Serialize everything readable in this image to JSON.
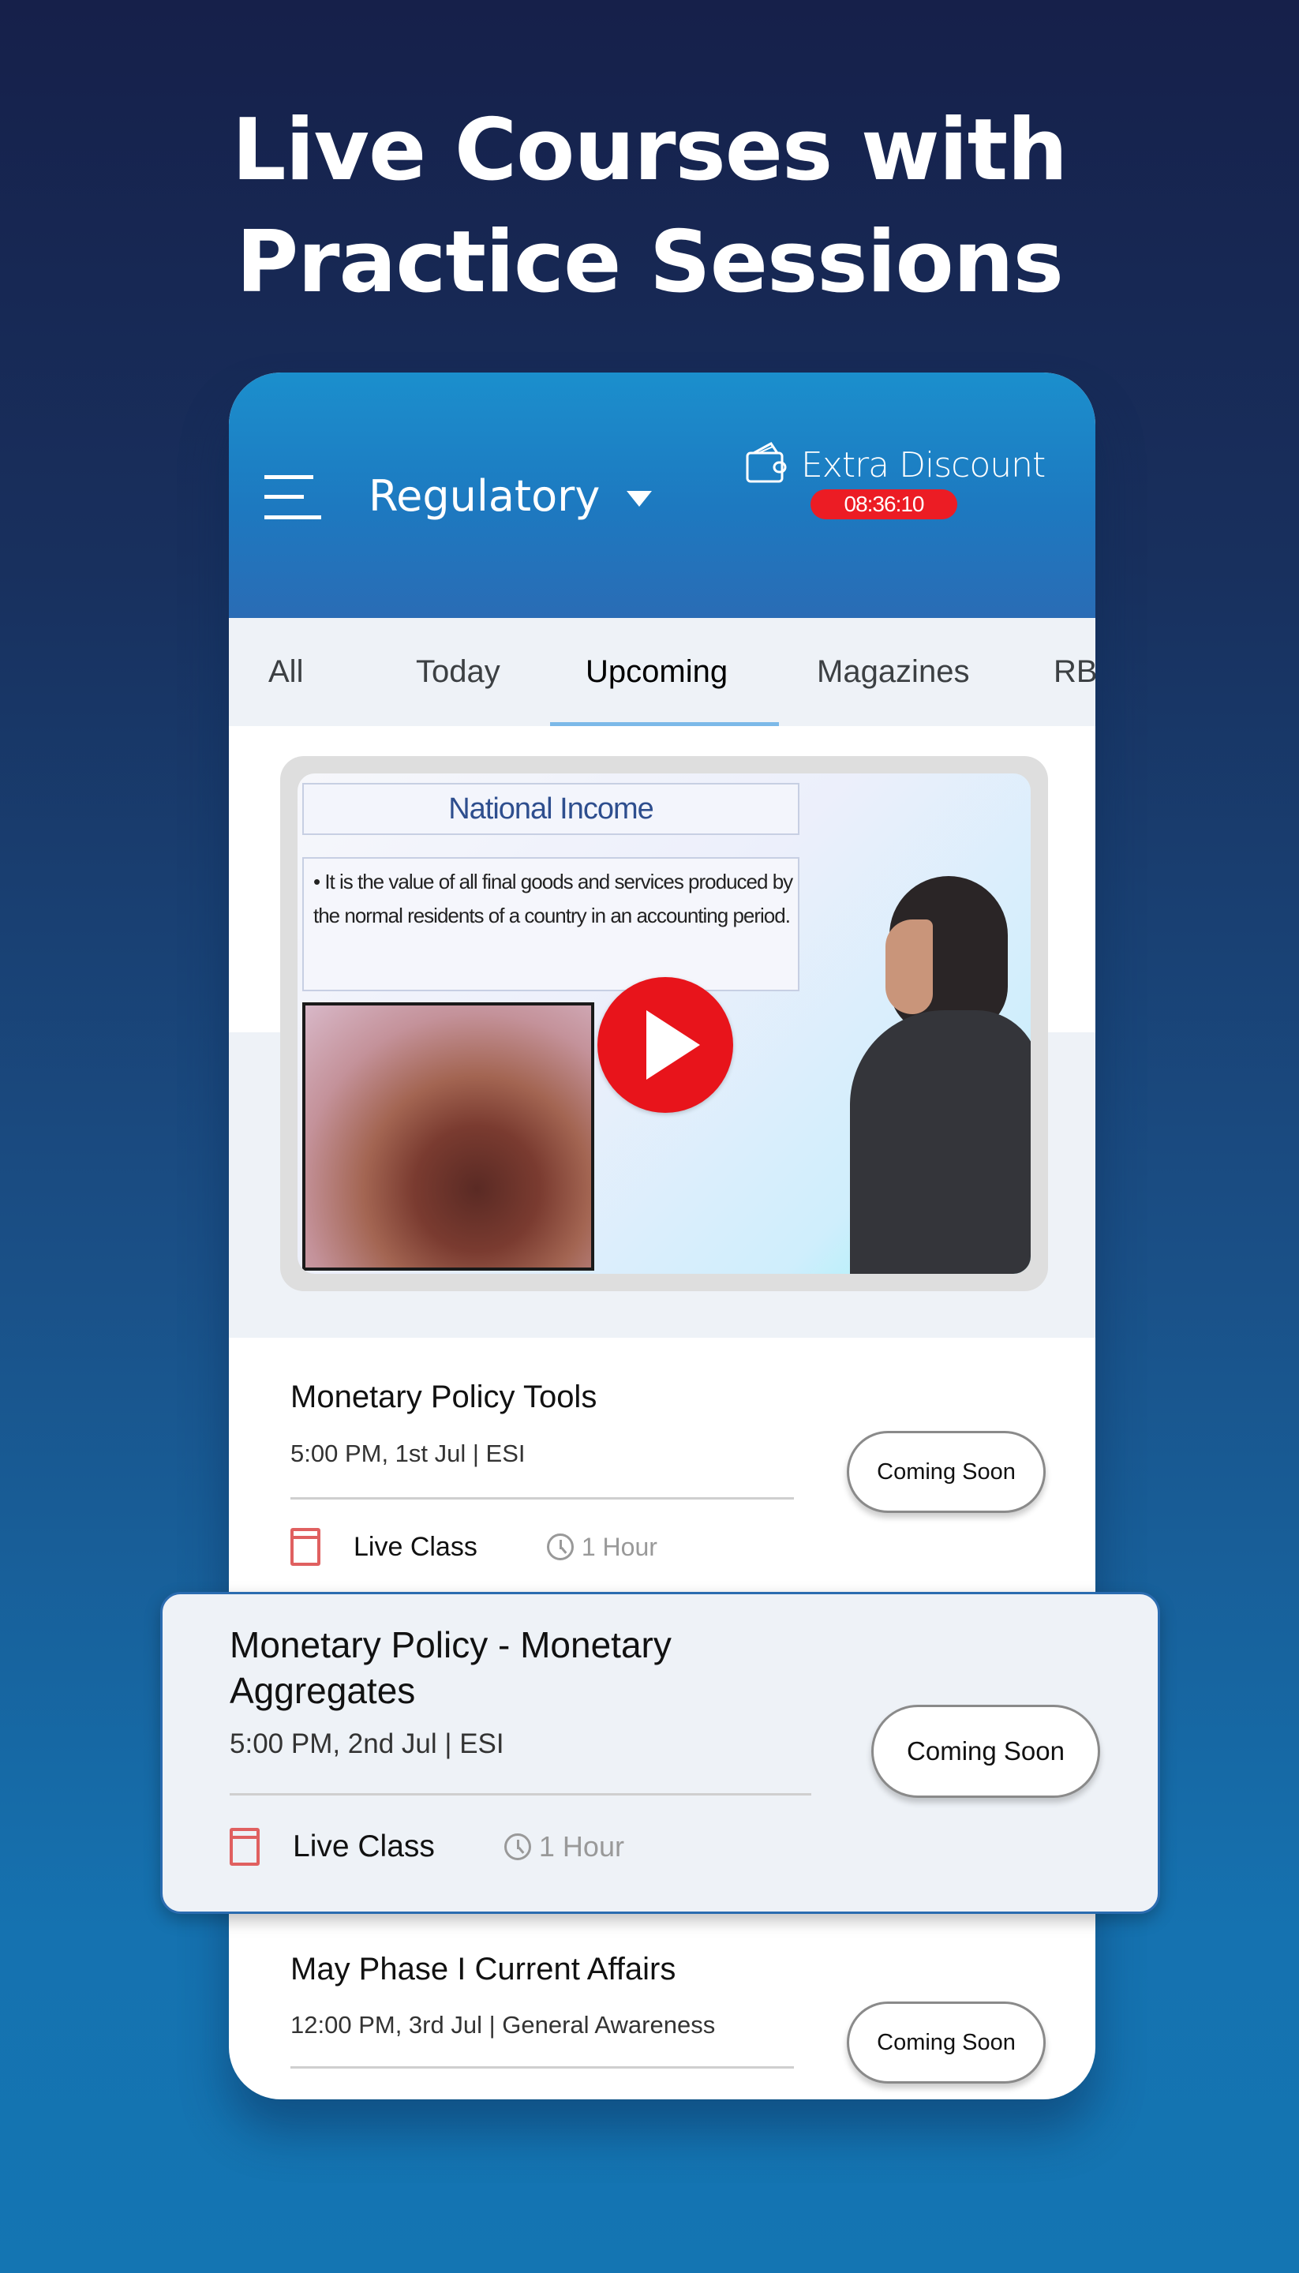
{
  "promo": {
    "headline_line1": "Live Courses with",
    "headline_line2": "Practice Sessions"
  },
  "header": {
    "menu_icon": "hamburger-menu-icon",
    "category": "Regulatory",
    "category_icon": "caret-down-icon",
    "discount_icon": "wallet-icon",
    "discount_label": "Extra Discount",
    "discount_timer": "08:36:10"
  },
  "tabs": [
    {
      "label": "All",
      "active": false
    },
    {
      "label": "Today",
      "active": false
    },
    {
      "label": "Upcoming",
      "active": true
    },
    {
      "label": "Magazines",
      "active": false
    },
    {
      "label": "RB",
      "active": false
    }
  ],
  "video": {
    "slide_title": "National Income",
    "slide_body": "• It is the value of all final goods and services produced by the normal residents of a country in an accounting period.",
    "play_icon": "play-icon"
  },
  "sessions": [
    {
      "title": "Monetary Policy Tools",
      "subtitle": "5:00 PM, 1st Jul | ESI",
      "type": "Live Class",
      "duration": "1 Hour",
      "button": "Coming Soon"
    },
    {
      "title": "Monetary Policy - Monetary Aggregates",
      "subtitle": "5:00 PM, 2nd Jul | ESI",
      "type": "Live Class",
      "duration": "1 Hour",
      "button": "Coming Soon"
    },
    {
      "title": "May Phase I Current Affairs",
      "subtitle": "12:00 PM, 3rd Jul | General Awareness",
      "button": "Coming Soon"
    }
  ],
  "colors": {
    "header_blue": "#1d79c0",
    "timer_red": "#ec1c24",
    "tab_underline": "#7cb9e8",
    "play_red": "#e8141b",
    "live_class_icon": "#e06060"
  }
}
